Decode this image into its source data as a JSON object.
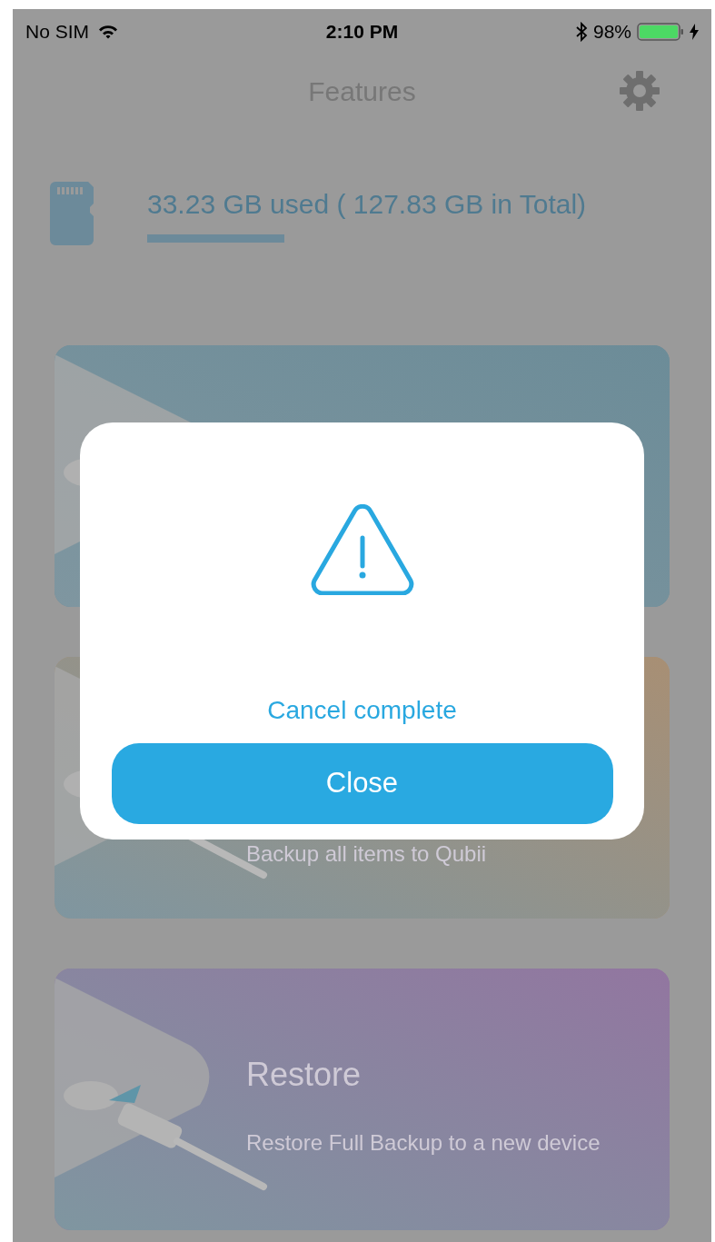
{
  "status_bar": {
    "carrier": "No SIM",
    "time": "2:10 PM",
    "battery": "98%"
  },
  "header": {
    "title": "Features"
  },
  "storage": {
    "text": "33.23 GB used ( 127.83 GB in Total)"
  },
  "features": [
    {
      "color": "#6c8c98"
    },
    {
      "color": "#a88f74",
      "subtitle": "Backup all items to Qubii"
    },
    {
      "color": "#9276a0",
      "title": "Restore",
      "subtitle": "Restore Full Backup to a new device"
    }
  ],
  "dialog": {
    "message": "Cancel complete",
    "button": "Close"
  }
}
